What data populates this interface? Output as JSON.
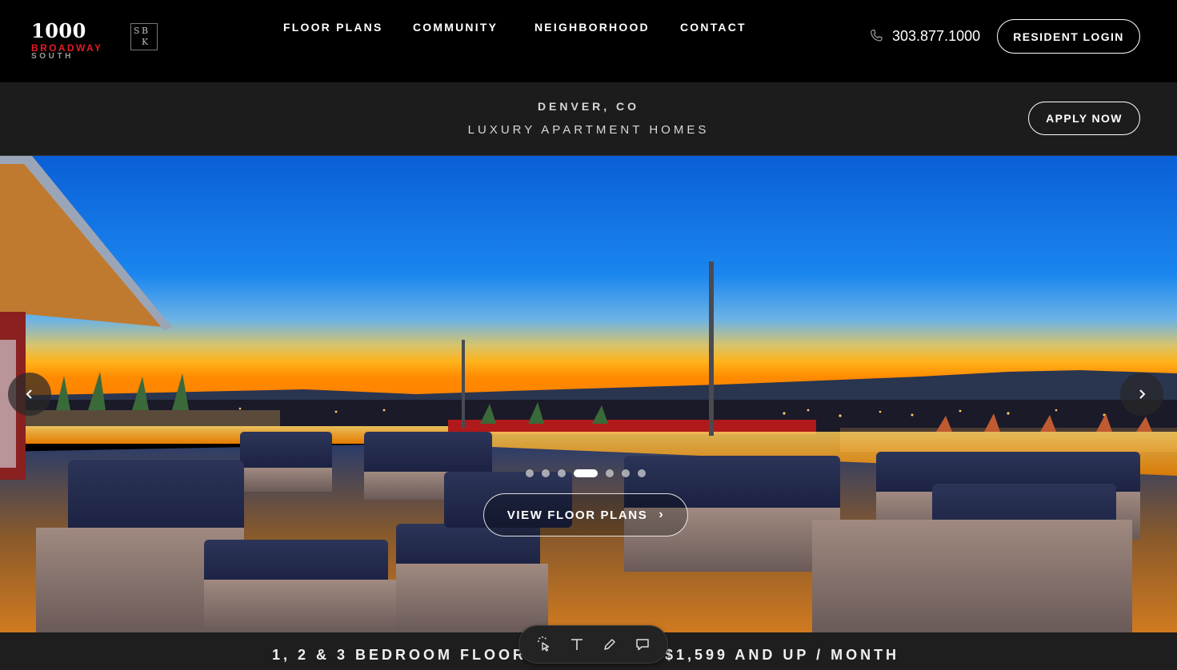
{
  "header": {
    "logo": {
      "number": "1000",
      "line2": "BROADWAY",
      "line3": "SOUTH",
      "mark": "SBK"
    },
    "nav": [
      {
        "label": "FLOOR PLANS"
      },
      {
        "label": "COMMUNITY"
      },
      {
        "label": "NEIGHBORHOOD"
      },
      {
        "label": "CONTACT"
      }
    ],
    "phone": {
      "icon": "phone-icon",
      "number": "303.877.1000"
    },
    "resident_login": "RESIDENT LOGIN"
  },
  "subheader": {
    "city": "DENVER, CO",
    "tagline": "LUXURY APARTMENT HOMES",
    "apply": "APPLY NOW"
  },
  "hero": {
    "image": "rooftop-terrace-sunset",
    "prev_icon": "chevron-left-icon",
    "next_icon": "chevron-right-icon",
    "slide_count": 7,
    "active_slide": 4,
    "cta": "VIEW FLOOR PLANS",
    "cta_icon": "chevron-right-icon"
  },
  "bottom": {
    "left_text": "1, 2 & 3 BEDROOM FLOORP",
    "right_text": "$1,599 AND UP / MONTH"
  },
  "toolbar": {
    "tools": [
      "select-icon",
      "text-icon",
      "pen-icon",
      "comment-icon"
    ]
  },
  "colors": {
    "brand_red": "#e31c24",
    "background": "#000000",
    "subheader_bg": "#1c1c1c"
  }
}
